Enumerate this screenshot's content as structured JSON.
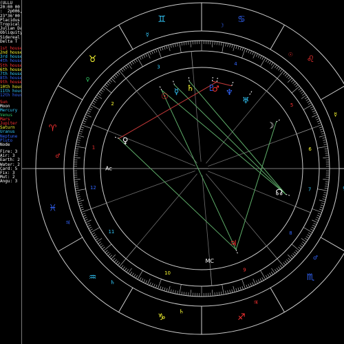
{
  "colors": {
    "background": "#000000",
    "wheel_line": "#cfcfcf",
    "fire": "#ff3333",
    "earth": "#ffff33",
    "air": "#33ccff",
    "water": "#3366ff",
    "green": "#33cc66",
    "white": "#ffffff",
    "aspect_green": "#5fae6a",
    "aspect_red": "#c83a3a",
    "aspect_grey": "#8a8a8a"
  },
  "sidebar": {
    "lines": [
      {
        "text": "(ULLU",
        "color": "#ffffff"
      },
      {
        "text": "20:00 00",
        "color": "#ffffff"
      },
      {
        "text": ":  2p006, 6",
        "color": "#ffffff"
      },
      {
        "text": "23\"36'00",
        "color": "#ffffff"
      },
      {
        "text": "Placidus",
        "color": "#ffffff"
      },
      {
        "text": "Tropical",
        "color": "#ffffff"
      },
      {
        "text": "Julian Da",
        "color": "#ffffff"
      },
      {
        "text": "Obliquity",
        "color": "#ffffff"
      },
      {
        "text": "Sidereal",
        "color": "#ffffff"
      },
      {
        "text": "Delta T",
        "color": "#ffffff"
      },
      {
        "text": "1st house",
        "color": "#ff3333"
      },
      {
        "text": "2nd house",
        "color": "#ffff33"
      },
      {
        "text": "3rd house",
        "color": "#33ccff"
      },
      {
        "text": "4th house",
        "color": "#3366ff"
      },
      {
        "text": "5th house",
        "color": "#ff3333"
      },
      {
        "text": "6th house",
        "color": "#ffff33"
      },
      {
        "text": "7th house",
        "color": "#33ccff"
      },
      {
        "text": "8th house",
        "color": "#3366ff"
      },
      {
        "text": "9th house",
        "color": "#ff3333"
      },
      {
        "text": "10th house",
        "color": "#ffff33"
      },
      {
        "text": "11th house",
        "color": "#33ccff"
      },
      {
        "text": "12th house",
        "color": "#3366ff"
      },
      {
        "text": "Sun",
        "color": "#ff3333"
      },
      {
        "text": "Moon",
        "color": "#ffffff"
      },
      {
        "text": "Mercury",
        "color": "#33ccff"
      },
      {
        "text": "Venus",
        "color": "#33cc66"
      },
      {
        "text": "Mars",
        "color": "#ff3333"
      },
      {
        "text": "Jupiter",
        "color": "#ff3333"
      },
      {
        "text": "Saturn",
        "color": "#ffff33"
      },
      {
        "text": "Uranus",
        "color": "#33ccff"
      },
      {
        "text": "Neptune",
        "color": "#3366ff"
      },
      {
        "text": "Pluto",
        "color": "#3366ff"
      },
      {
        "text": "Node",
        "color": "#ffffff"
      },
      {
        "text": "Fire: 3",
        "color": "#ffffff"
      },
      {
        "text": "Air: 3",
        "color": "#ffffff"
      },
      {
        "text": "Earth: 2",
        "color": "#ffffff"
      },
      {
        "text": "Water: 2",
        "color": "#ffffff"
      },
      {
        "text": "Card: 5",
        "color": "#ffffff"
      },
      {
        "text": "Fix: 3",
        "color": "#ffffff"
      },
      {
        "text": "Mut: 2",
        "color": "#ffffff"
      },
      {
        "text": "Angu: 3",
        "color": "#ffffff"
      }
    ]
  },
  "chart": {
    "zodiac_signs": [
      {
        "name": "aries",
        "glyph": "♈",
        "element": "fire",
        "longitude": 15
      },
      {
        "name": "taurus",
        "glyph": "♉",
        "element": "earth",
        "longitude": 45
      },
      {
        "name": "gemini",
        "glyph": "♊",
        "element": "air",
        "longitude": 75
      },
      {
        "name": "cancer",
        "glyph": "♋",
        "element": "water",
        "longitude": 105
      },
      {
        "name": "leo",
        "glyph": "♌",
        "element": "fire",
        "longitude": 135
      },
      {
        "name": "virgo",
        "glyph": "♍",
        "element": "earth",
        "longitude": 165
      },
      {
        "name": "libra",
        "glyph": "♎",
        "element": "air",
        "longitude": 195
      },
      {
        "name": "scorpio",
        "glyph": "♏",
        "element": "water",
        "longitude": 225
      },
      {
        "name": "sagittarius",
        "glyph": "♐",
        "element": "fire",
        "longitude": 255
      },
      {
        "name": "capricorn",
        "glyph": "♑",
        "element": "earth",
        "longitude": 285
      },
      {
        "name": "aquarius",
        "glyph": "♒",
        "element": "air",
        "longitude": 315
      },
      {
        "name": "pisces",
        "glyph": "♓",
        "element": "water",
        "longitude": 345
      }
    ],
    "ruler_symbols": [
      {
        "glyph": "♂",
        "color": "#ff3333",
        "longitude": 5
      },
      {
        "glyph": "♀",
        "color": "#33cc66",
        "longitude": 38
      },
      {
        "glyph": "☿",
        "color": "#33ccff",
        "longitude": 68
      },
      {
        "glyph": "☽",
        "color": "#3366ff",
        "longitude": 98
      },
      {
        "glyph": "☉",
        "color": "#ff3333",
        "longitude": 128
      },
      {
        "glyph": "☿",
        "color": "#ffff33",
        "longitude": 158
      },
      {
        "glyph": "♀",
        "color": "#33ccff",
        "longitude": 188
      },
      {
        "glyph": "♂",
        "color": "#3366ff",
        "longitude": 218
      },
      {
        "glyph": "♃",
        "color": "#ff3333",
        "longitude": 248
      },
      {
        "glyph": "♄",
        "color": "#ffff33",
        "longitude": 278
      },
      {
        "glyph": "♄",
        "color": "#33ccff",
        "longitude": 308
      },
      {
        "glyph": "♃",
        "color": "#3366ff",
        "longitude": 338
      }
    ],
    "house_cusps": [
      0,
      22,
      50,
      85,
      130,
      160,
      180,
      202,
      230,
      265,
      310,
      340
    ],
    "house_labels": [
      {
        "number": "1",
        "longitude": 11,
        "color": "#ff3333"
      },
      {
        "number": "2",
        "longitude": 36,
        "color": "#ffff33"
      },
      {
        "number": "3",
        "longitude": 67,
        "color": "#33ccff"
      },
      {
        "number": "4",
        "longitude": 108,
        "color": "#3366ff"
      },
      {
        "number": "5",
        "longitude": 145,
        "color": "#ff3333"
      },
      {
        "number": "6",
        "longitude": 170,
        "color": "#ffff33"
      },
      {
        "number": "7",
        "longitude": 191,
        "color": "#33ccff"
      },
      {
        "number": "8",
        "longitude": 216,
        "color": "#3366ff"
      },
      {
        "number": "9",
        "longitude": 247,
        "color": "#ff3333"
      },
      {
        "number": "10",
        "longitude": 288,
        "color": "#ffff33"
      },
      {
        "number": "11",
        "longitude": 325,
        "color": "#33ccff"
      },
      {
        "number": "12",
        "longitude": 350,
        "color": "#3366ff"
      }
    ],
    "angle_labels": [
      {
        "label": "Asc",
        "glyph": "Ac",
        "longitude": 0
      },
      {
        "label": "MC",
        "glyph": "MC",
        "longitude": 265
      }
    ],
    "planets": [
      {
        "name": "sun",
        "glyph": "☉",
        "color": "#ff3333",
        "longitude": 63
      },
      {
        "name": "moon",
        "glyph": "☽",
        "color": "#ffffff",
        "longitude": 148
      },
      {
        "name": "mercury",
        "glyph": "☿",
        "color": "#33ccff",
        "longitude": 72
      },
      {
        "name": "venus",
        "glyph": "♀",
        "color": "#ffffff",
        "longitude": 20
      },
      {
        "name": "mars",
        "glyph": "♂",
        "color": "#ff3333",
        "longitude": 100
      },
      {
        "name": "jupiter",
        "glyph": "♃",
        "color": "#ff3333",
        "longitude": 247
      },
      {
        "name": "saturn",
        "glyph": "♄",
        "color": "#ffff33",
        "longitude": 82
      },
      {
        "name": "uranus",
        "glyph": "♅",
        "color": "#33ccff",
        "longitude": 123
      },
      {
        "name": "neptune",
        "glyph": "♆",
        "color": "#3366ff",
        "longitude": 110
      },
      {
        "name": "pluto",
        "glyph": "♇",
        "color": "#3366ff",
        "longitude": 97
      },
      {
        "name": "node",
        "glyph": "☊",
        "color": "#ffffff",
        "longitude": 197
      }
    ],
    "aspects": [
      {
        "from": "sun",
        "to": "jupiter",
        "color": "#5fae6a"
      },
      {
        "from": "sun",
        "to": "node",
        "color": "#5fae6a"
      },
      {
        "from": "venus",
        "to": "jupiter",
        "color": "#5fae6a"
      },
      {
        "from": "jupiter",
        "to": "moon",
        "color": "#5fae6a"
      },
      {
        "from": "node",
        "to": "mercury",
        "color": "#5fae6a"
      },
      {
        "from": "venus",
        "to": "mars",
        "color": "#c83a3a"
      },
      {
        "from": "saturn",
        "to": "node",
        "color": "#5fae6a"
      },
      {
        "from": "pluto",
        "to": "neptune",
        "color": "#c83a3a"
      }
    ]
  }
}
